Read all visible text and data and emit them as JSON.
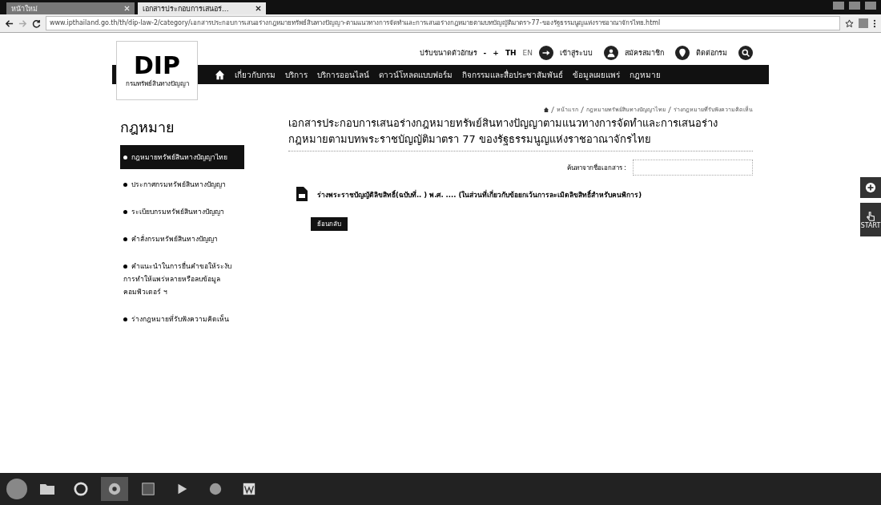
{
  "browser": {
    "tabs": [
      {
        "title": "หน้าใหม่",
        "selected": false
      },
      {
        "title": "เอกสารประกอบการเสนอร่...",
        "selected": true
      }
    ],
    "url": "www.ipthailand.go.th/th/dip-law-2/category/เอกสารประกอบการเสนอร่างกฎหมายทรัพย์สินทางปัญญา-ตามแนวทางการจัดทำและการเสนอร่างกฎหมายตามบทบัญญัติมาตรา-77-ของรัฐธรรมนูญแห่งราชอาณาจักรไทย.html"
  },
  "header": {
    "logo": "DIP",
    "logo_caption": "กรมทรัพย์สินทางปัญญา",
    "font_size_label": "ปรับขนาดตัวอักษร",
    "font_sizes": [
      "-",
      "+"
    ],
    "languages": [
      {
        "label": "TH",
        "selected": true
      },
      {
        "label": "EN",
        "selected": false
      }
    ],
    "links": [
      {
        "label": "เข้าสู่ระบบ",
        "kind": "login"
      },
      {
        "label": "สมัครสมาชิก",
        "kind": "register"
      },
      {
        "label": "ติดต่อกรม",
        "kind": "contact"
      }
    ]
  },
  "nav": [
    "เกี่ยวกับกรม",
    "บริการ",
    "บริการออนไลน์",
    "ดาวน์โหลดแบบฟอร์ม",
    "กิจกรรมและสื่อประชาสัมพันธ์",
    "ข้อมูลเผยแพร่",
    "กฎหมาย"
  ],
  "breadcrumb": [
    "หน้าแรก",
    "กฎหมายทรัพย์สินทางปัญญาไทย",
    "ร่างกฎหมายที่รับฟังความคิดเห็น"
  ],
  "sidebar": {
    "title": "กฎหมาย",
    "items": [
      {
        "label": "กฎหมายทรัพย์สินทางปัญญาไทย",
        "selected": true
      },
      {
        "label": "ประกาศกรมทรัพย์สินทางปัญญา",
        "selected": false
      },
      {
        "label": "ระเบียบกรมทรัพย์สินทางปัญญา",
        "selected": false
      },
      {
        "label": "คำสั่งกรมทรัพย์สินทางปัญญา",
        "selected": false
      },
      {
        "label": "คำแนะนำในการยื่นคำขอให้ระงับการทำให้แพร่หลายหรือลบข้อมูลคอมพิวเตอร์ ฯ",
        "selected": false
      },
      {
        "label": "ร่างกฎหมายที่รับฟังความคิดเห็น",
        "selected": false
      }
    ]
  },
  "content": {
    "title": "เอกสารประกอบการเสนอร่างกฎหมายทรัพย์สินทางปัญญาตามแนวทางการจัดทำและการเสนอร่างกฎหมายตามบทพระราชบัญญัติมาตรา 77 ของรัฐธรรมนูญแห่งราชอาณาจักรไทย",
    "search_label": "ค้นหาจากชื่อเอกสาร :",
    "documents": [
      "ร่างพระราชบัญญัติลิขสิทธิ์(ฉบับที่.. ) พ.ศ. .... (ในส่วนที่เกี่ยวกับข้อยกเว้นการละเมิดลิขสิทธิ์สำหรับคนพิการ)"
    ],
    "back_button": "ย้อนกลับ"
  },
  "float_buttons": [
    {
      "kind": "plus"
    },
    {
      "kind": "start",
      "label": "START"
    }
  ]
}
